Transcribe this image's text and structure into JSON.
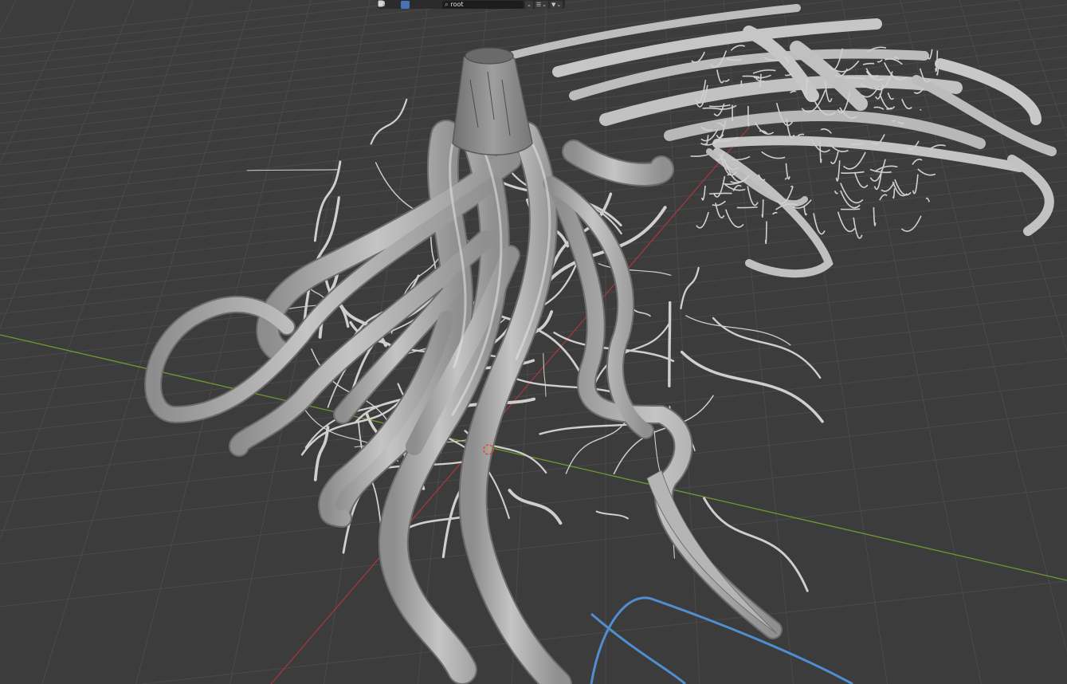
{
  "header": {
    "search": {
      "value": "root",
      "icon": "search-icon"
    },
    "filter_chevron": "⌄",
    "icons": {
      "material_preview": "sphere-icon",
      "object_mode": "cursor-icon",
      "solid": "cube-icon",
      "overlay": "overlay-icon",
      "view_layer": "globe-icon",
      "display_mode": "list-icon",
      "filter": "funnel-icon"
    },
    "dropdown_glyph": "⌄"
  },
  "viewport": {
    "background": "#3c3c3c",
    "grid_color": "#4a4a4a",
    "x_axis_color": "#a3383c",
    "y_axis_color": "#6e9a2e",
    "mesh_color": "#b9b9b9",
    "curve_color": "#4f8ed0"
  }
}
